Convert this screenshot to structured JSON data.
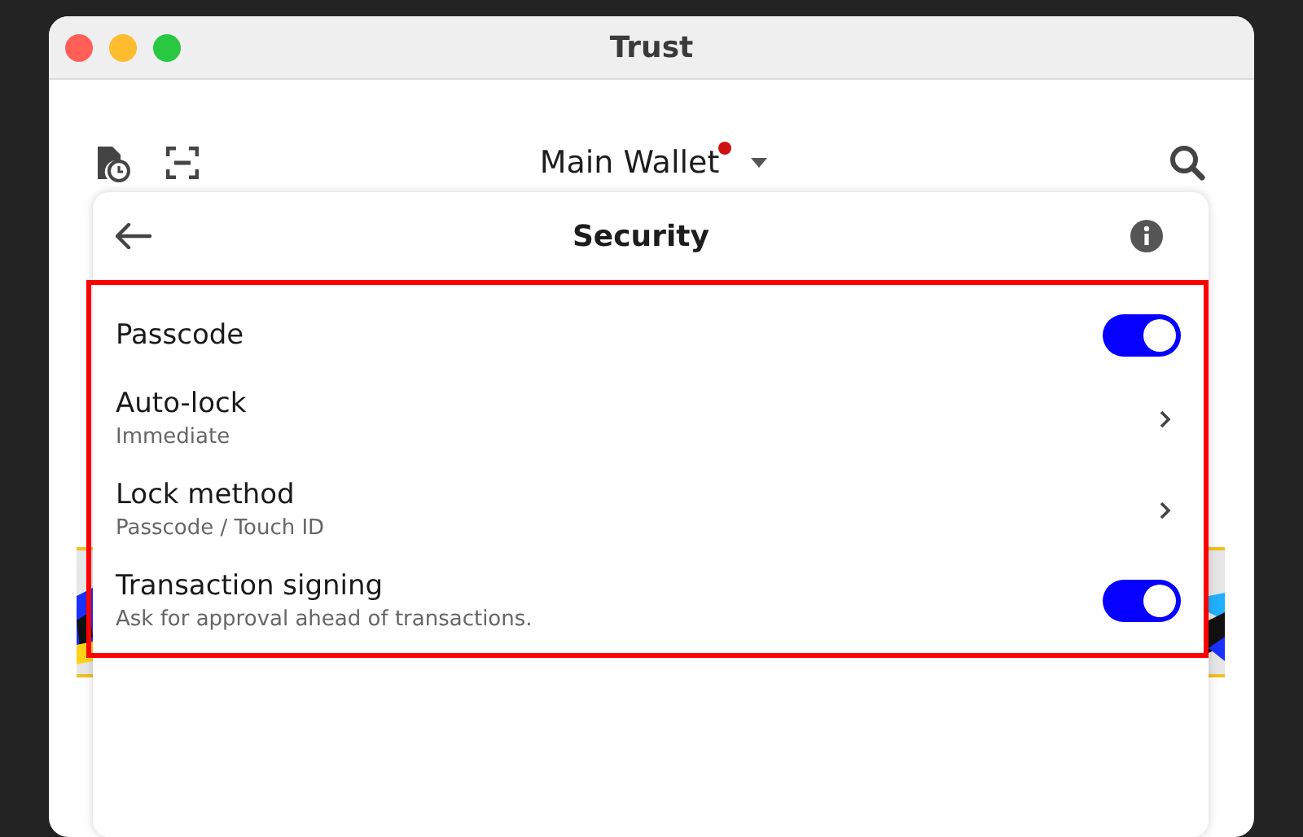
{
  "window": {
    "title": "Trust"
  },
  "header": {
    "wallet_name": "Main Wallet",
    "notification": true
  },
  "panel": {
    "title": "Security",
    "highlighted": true,
    "settings": [
      {
        "kind": "toggle",
        "label": "Passcode",
        "on": true
      },
      {
        "kind": "link",
        "label": "Auto-lock",
        "value": "Immediate"
      },
      {
        "kind": "link",
        "label": "Lock method",
        "value": "Passcode / Touch ID"
      },
      {
        "kind": "toggle",
        "label": "Transaction signing",
        "description": "Ask for approval ahead of transactions.",
        "on": true
      }
    ]
  }
}
